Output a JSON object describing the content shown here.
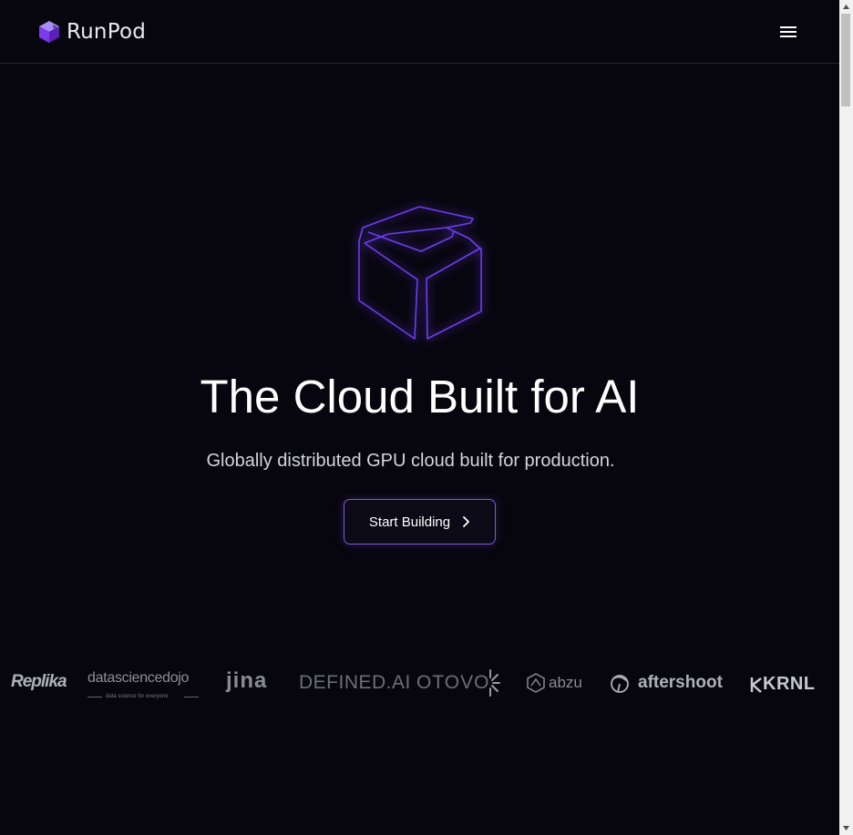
{
  "header": {
    "brand_name": "RunPod",
    "brand_icon": "cube-logo-icon",
    "menu_icon": "hamburger-menu-icon"
  },
  "hero": {
    "illustration": "cube-outline-icon",
    "title": "The Cloud Built for AI",
    "subtitle": "Globally distributed GPU cloud built for production.",
    "cta_label": "Start Building",
    "cta_icon": "chevron-right-icon"
  },
  "logos": {
    "replika": "Replika",
    "datasciencedojo": "datasciencedojo",
    "datasciencedojo_tag": "data science for everyone",
    "jina": "jina",
    "defined": "DEFINED.AI",
    "otovo": "OTOVO",
    "abzu": "abzu",
    "aftershoot": "aftershoot",
    "krnl": "KRNL"
  },
  "colors": {
    "background": "#07060f",
    "accent": "#7c5bd9",
    "brand_purple": "#8b5cf6"
  }
}
